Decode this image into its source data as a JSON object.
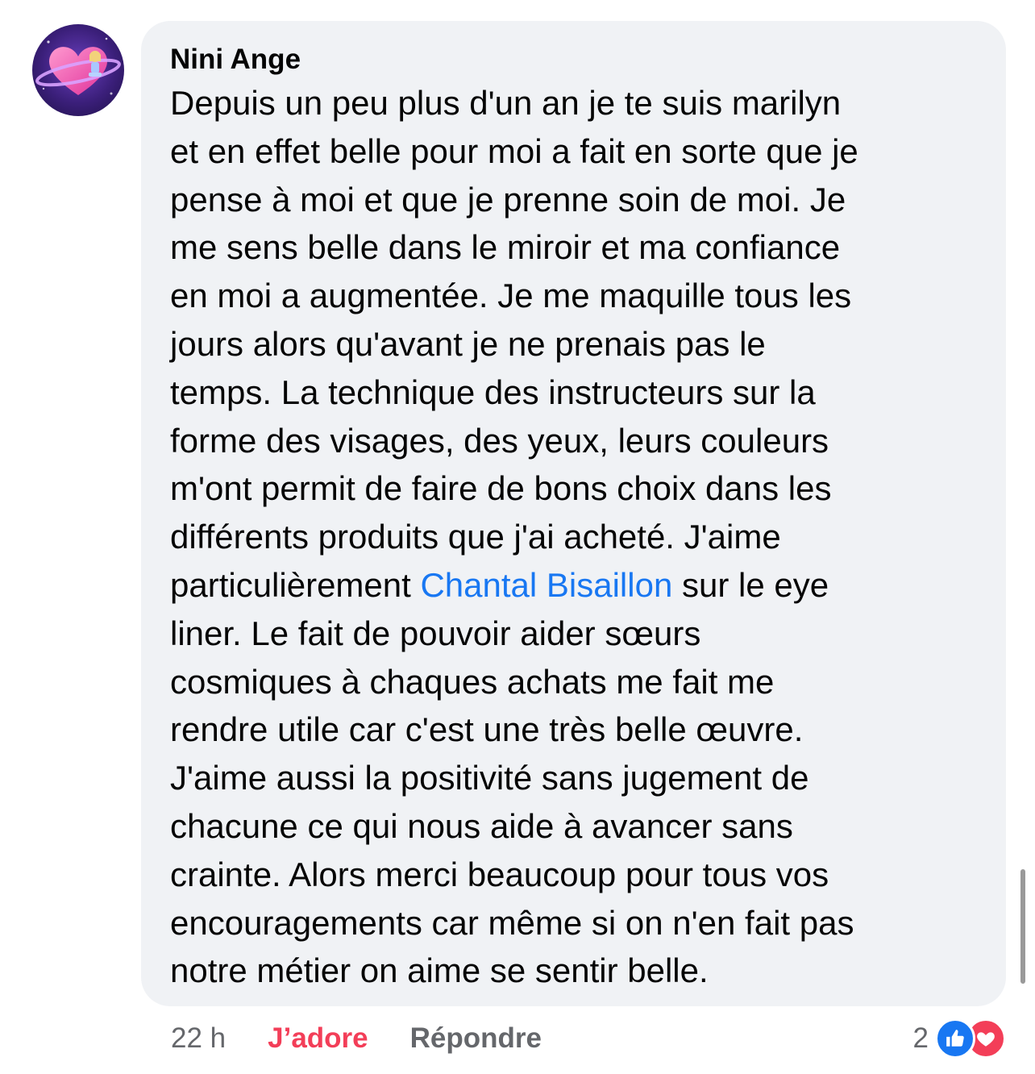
{
  "comment": {
    "author": "Nini Ange",
    "lines": [
      {
        "text": "Depuis un peu plus d'un an je te suis marilyn"
      },
      {
        "text": "et en effet belle pour moi a fait en sorte que je"
      },
      {
        "text": "pense à moi et que je prenne soin de moi. Je"
      },
      {
        "text": "me sens belle dans le miroir et ma confiance"
      },
      {
        "text": "en moi a augmentée. Je me maquille tous les"
      },
      {
        "text": "jours alors qu'avant je ne prenais pas le"
      },
      {
        "text": "temps. La technique des instructeurs sur la"
      },
      {
        "text": "forme des visages, des yeux, leurs couleurs"
      },
      {
        "text": "m'ont permit de faire de bons choix dans les"
      },
      {
        "text": "différents produits que j'ai acheté. J'aime"
      },
      {
        "before": "particulièrement ",
        "mention": "Chantal Bisaillon",
        "after": " sur le eye"
      },
      {
        "text": "liner. Le fait de pouvoir aider sœurs"
      },
      {
        "text": "cosmiques à chaques achats me fait me"
      },
      {
        "text": "rendre utile car c'est une très belle œuvre."
      },
      {
        "text": "J'aime aussi la positivité sans jugement de"
      },
      {
        "text": "chacune ce qui nous aide à avancer sans"
      },
      {
        "text": "crainte. Alors merci beaucoup pour tous vos"
      },
      {
        "text": "encouragements car même si on n'en fait pas"
      },
      {
        "text": "notre métier on aime se sentir belle."
      }
    ]
  },
  "actions": {
    "time": "22 h",
    "love_label": "J’adore",
    "reply_label": "Répondre"
  },
  "reactions": {
    "count": "2",
    "types": [
      "like-icon",
      "love-icon"
    ]
  },
  "colors": {
    "bubble": "#f0f2f5",
    "mention": "#1877f2",
    "love": "#f33e58",
    "secondary_text": "#65676b",
    "like": "#1877f2"
  }
}
